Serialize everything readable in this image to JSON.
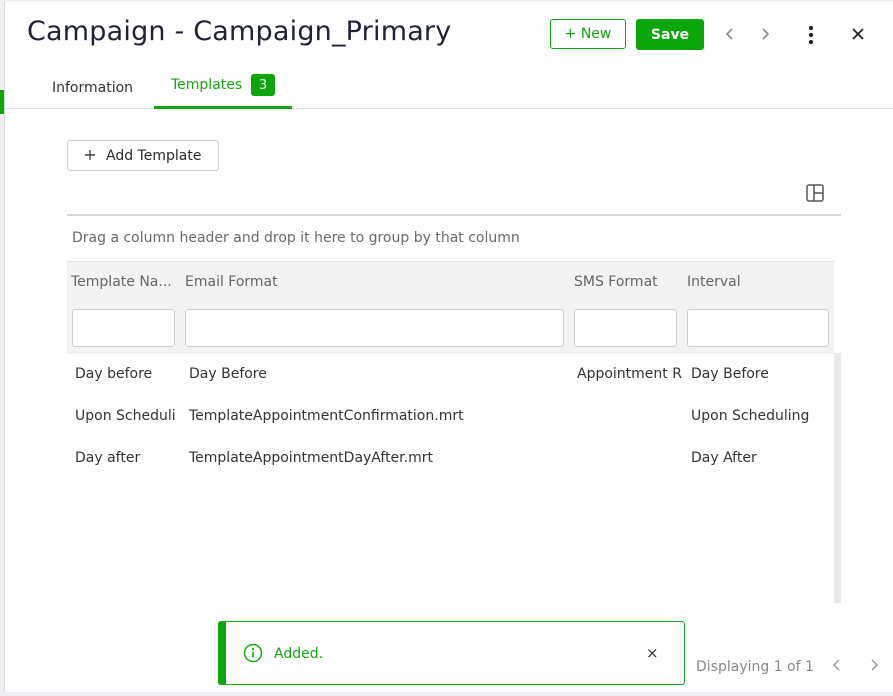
{
  "window": {
    "title": "Campaign - Campaign_Primary"
  },
  "toolbar": {
    "new_label": "+ New",
    "save_label": "Save",
    "prev_icon": "chevron-left-icon",
    "next_icon": "chevron-right-icon",
    "more_icon": "more-vertical-icon",
    "close_icon": "close-icon"
  },
  "tabs": [
    {
      "label": "Information"
    },
    {
      "label": "Templates",
      "badge": "3",
      "active": true
    }
  ],
  "actions": {
    "add_template_label": "Add Template"
  },
  "grid": {
    "group_hint": "Drag a column header and drop it here to group by that column",
    "columns": [
      "Template Na...",
      "Email Format",
      "SMS Format",
      "Interval"
    ],
    "rows": [
      [
        "Day before",
        "Day Before",
        "Appointment R",
        "Day Before"
      ],
      [
        "Upon Scheduli",
        "TemplateAppointmentConfirmation.mrt",
        "",
        "Upon Scheduling"
      ],
      [
        "Day after",
        "TemplateAppointmentDayAfter.mrt",
        "",
        "Day After"
      ]
    ]
  },
  "pager": {
    "text": "Displaying 1 of 1"
  },
  "toast": {
    "message": "Added.",
    "close_glyph": "×"
  },
  "colors": {
    "accent": "#0aa60a",
    "text": "#1f2233",
    "muted": "#6a6a6a"
  }
}
